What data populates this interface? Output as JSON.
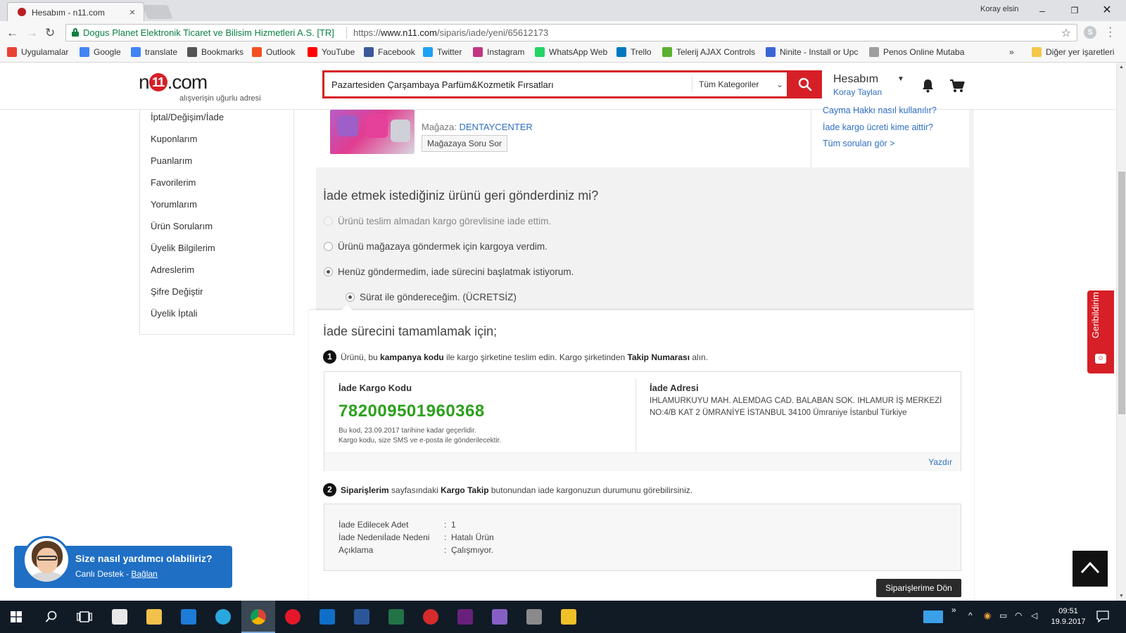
{
  "browser": {
    "tab_title": "Hesabım - n11.com",
    "tab_close": "×",
    "profile_name": "Koray elsin",
    "cert_name": "Dogus Planet Elektronik Ticaret ve Bilisim Hizmetleri A.S. [TR]",
    "url_prefix": "https://",
    "url_host": "www.n11.com",
    "url_path": "/siparis/iade/yeni/65612173",
    "bookmarks": [
      {
        "label": "Uygulamalar",
        "icon": "apps-icon",
        "color": "#e94235"
      },
      {
        "label": "Google",
        "icon": "google-icon",
        "color": "#4285f4"
      },
      {
        "label": "translate",
        "icon": "google-icon",
        "color": "#4285f4"
      },
      {
        "label": "Bookmarks",
        "icon": "star-icon",
        "color": "#555555"
      },
      {
        "label": "Outlook",
        "icon": "windows-icon",
        "color": "#f25022"
      },
      {
        "label": "YouTube",
        "icon": "youtube-icon",
        "color": "#ff0000"
      },
      {
        "label": "Facebook",
        "icon": "facebook-icon",
        "color": "#3b5998"
      },
      {
        "label": "Twitter",
        "icon": "twitter-icon",
        "color": "#1da1f2"
      },
      {
        "label": "Instagram",
        "icon": "instagram-icon",
        "color": "#c13584"
      },
      {
        "label": "WhatsApp Web",
        "icon": "whatsapp-icon",
        "color": "#25d366"
      },
      {
        "label": "Trello",
        "icon": "trello-icon",
        "color": "#0079bf"
      },
      {
        "label": "Telerij AJAX Controls",
        "icon": "telerik-icon",
        "color": "#5ab031"
      },
      {
        "label": "Ninite - Install or Upc",
        "icon": "ninite-icon",
        "color": "#3b66d6"
      },
      {
        "label": "Penos Online Mutaba",
        "icon": "page-icon",
        "color": "#9e9e9e"
      }
    ],
    "bookmarks_more": "»",
    "other_bookmarks": "Diğer yer işaretleri"
  },
  "header": {
    "logo_n": "n",
    "logo_one": "11",
    "logo_com": ".com",
    "tagline": "alışverişin uğurlu adresi",
    "search_value": "Pazartesiden Çarşambaya Parfüm&Kozmetik Fırsatları",
    "category": "Tüm Kategoriler",
    "account_title": "Hesabım",
    "account_name": "Koray Taylan"
  },
  "sidebar": {
    "items": [
      "İptal/Değişim/İade",
      "Kuponlarım",
      "Puanlarım",
      "Favorilerim",
      "Yorumlarım",
      "Ürün Sorularım",
      "Üyelik Bilgilerim",
      "Adreslerim",
      "Şifre Değiştir",
      "Üyelik İptali"
    ]
  },
  "product": {
    "store_label": "Mağaza:",
    "store_name": "DENTAYCENTER",
    "ask_store": "Mağazaya Soru Sor",
    "faq": [
      "Cayma Hakkı nasıl kullanılır?",
      "İade kargo ücreti kime aittir?",
      "Tüm soruları gör >"
    ]
  },
  "question": {
    "title": "İade etmek istediğiniz ürünü geri gönderdiniz mi?",
    "options": [
      {
        "label": "Ürünü teslim almadan kargo görevlisine iade ettim.",
        "state": "disabled"
      },
      {
        "label": "Ürünü mağazaya göndermek için kargoya verdim.",
        "state": "unselected"
      },
      {
        "label": "Henüz göndermedim, iade sürecini başlatmak istiyorum.",
        "state": "selected"
      }
    ],
    "sub_option": "Sürat ile göndereceğim. (ÜCRETSİZ)"
  },
  "steps": {
    "title": "İade sürecini tamamlamak için;",
    "step1_num": "1",
    "step1_a": "Ürünü, bu ",
    "step1_b": "kampanya kodu",
    "step1_c": " ile kargo şirketine teslim edin. Kargo şirketinden ",
    "step1_d": "Takip Numarası",
    "step1_e": " alın.",
    "code_label": "İade Kargo Kodu",
    "code_value": "782009501960368",
    "code_note1": "Bu kod, 23.09.2017 tarihine kadar geçerlidir.",
    "code_note2": "Kargo kodu, size SMS ve e-posta ile gönderilecektir.",
    "address_label": "İade Adresi",
    "address_text": "IHLAMURKUYU MAH. ALEMDAG CAD. BALABAN SOK. IHLAMUR İŞ MERKEZİ NO:4/B KAT 2 ÜMRANİYE İSTANBUL 34100 Ümraniye İstanbul Türkiye",
    "print": "Yazdır",
    "step2_num": "2",
    "step2_a": "Siparişlerim",
    "step2_b": " sayfasındaki ",
    "step2_c": "Kargo Takip",
    "step2_d": " butonundan iade kargonuzun durumunu görebilirsiniz."
  },
  "details": {
    "rows": [
      {
        "label": "İade Edilecek Adet",
        "value": "1"
      },
      {
        "label": "İade Nedeniİade Nedeni",
        "value": "Hatalı Ürün"
      },
      {
        "label": "Açıklama",
        "value": "Çalışmıyor."
      }
    ],
    "colon": ":",
    "back_button": "Siparişlerime Dön"
  },
  "help": {
    "title": "Size nasıl yardımcı olabiliriz?",
    "sub_prefix": "Canlı Destek - ",
    "sub_link": "Bağlan"
  },
  "feedback": {
    "label": "Geribildirim"
  },
  "taskbar": {
    "time": "09:51",
    "date": "19.9.2017"
  },
  "colors": {
    "brand_red": "#d61f26",
    "link_blue": "#2f6fc4",
    "code_green": "#2ca01c"
  }
}
